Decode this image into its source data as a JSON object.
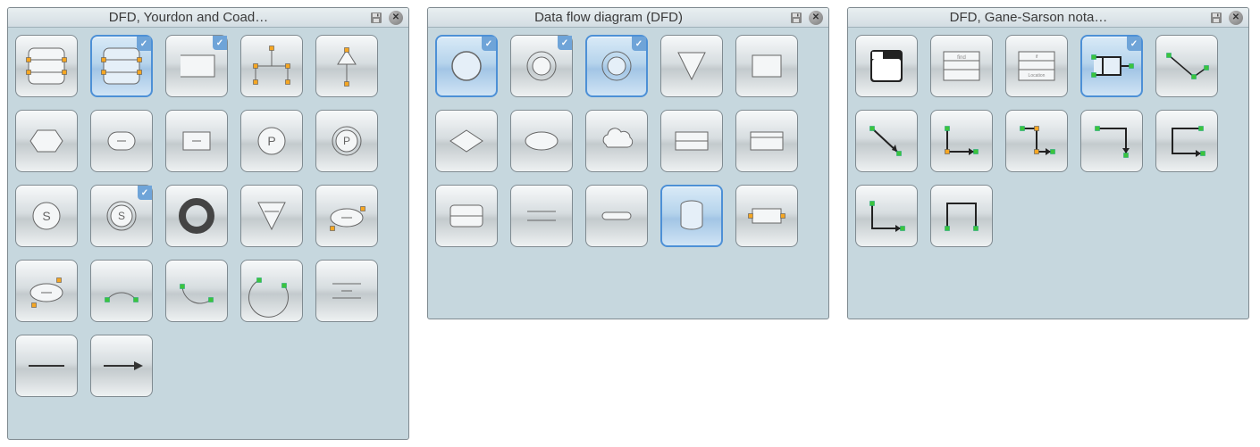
{
  "panels": [
    {
      "id": "yourdon",
      "title": "DFD, Yourdon and Coad…",
      "className": "panel-a",
      "shapes": [
        {
          "name": "data-store-1",
          "icon": "rows3",
          "handles": "o",
          "selected": false,
          "tick": false
        },
        {
          "name": "data-store-2",
          "icon": "rows3",
          "handles": "o",
          "selected": true,
          "tick": true
        },
        {
          "name": "data-store-open",
          "icon": "openrect",
          "selected": false,
          "tick": true
        },
        {
          "name": "tree-shape",
          "icon": "tree",
          "handles": "o",
          "selected": false,
          "tick": false
        },
        {
          "name": "triangle-up-branch",
          "icon": "triupline",
          "handles": "o",
          "selected": false,
          "tick": false
        },
        {
          "name": "hex-process",
          "icon": "hex",
          "selected": false,
          "tick": false
        },
        {
          "name": "rounded-minus",
          "icon": "roundminus",
          "selected": false,
          "tick": false
        },
        {
          "name": "rect-minus",
          "icon": "rectminus",
          "selected": false,
          "tick": false
        },
        {
          "name": "process-p",
          "icon": "circleP",
          "selected": false,
          "tick": false
        },
        {
          "name": "process-p-ring",
          "icon": "circlePring",
          "selected": false,
          "tick": false
        },
        {
          "name": "state-s",
          "icon": "circleS",
          "selected": false,
          "tick": false
        },
        {
          "name": "state-s-ring",
          "icon": "circleSring",
          "selected": false,
          "tick": true
        },
        {
          "name": "ring-bold",
          "icon": "boldring",
          "selected": false,
          "tick": false
        },
        {
          "name": "triangle-down",
          "icon": "tridown",
          "selected": false,
          "tick": false
        },
        {
          "name": "ellipse-minus-handles",
          "icon": "ellminus",
          "handles": "o",
          "selected": false,
          "tick": false
        },
        {
          "name": "ellipse-minus",
          "icon": "ellminus2",
          "handles": "o",
          "selected": false,
          "tick": false
        },
        {
          "name": "arc-handles-1",
          "icon": "arc",
          "handles": "g",
          "selected": false,
          "tick": false
        },
        {
          "name": "arc-handles-2",
          "icon": "arc2",
          "handles": "g",
          "selected": false,
          "tick": false
        },
        {
          "name": "arc-handles-3",
          "icon": "arc3",
          "handles": "g",
          "selected": false,
          "tick": false
        },
        {
          "name": "parallel-minus",
          "icon": "parminus",
          "selected": false,
          "tick": false
        },
        {
          "name": "line-plain",
          "icon": "line",
          "selected": false,
          "tick": false
        },
        {
          "name": "arrow-right",
          "icon": "arrow",
          "selected": false,
          "tick": false
        }
      ]
    },
    {
      "id": "dfd",
      "title": "Data flow diagram (DFD)",
      "className": "panel-b",
      "shapes": [
        {
          "name": "circle-big",
          "icon": "circle",
          "selected": true,
          "tick": true
        },
        {
          "name": "circle-ring",
          "icon": "ring",
          "selected": false,
          "tick": true
        },
        {
          "name": "circle-ring-sel",
          "icon": "ring",
          "selected": true,
          "tick": true
        },
        {
          "name": "triangle-down-outline",
          "icon": "tridownout",
          "selected": false,
          "tick": false
        },
        {
          "name": "rect-outline",
          "icon": "rect",
          "selected": false,
          "tick": false
        },
        {
          "name": "diamond",
          "icon": "diamond",
          "selected": false,
          "tick": false
        },
        {
          "name": "ellipse-outline",
          "icon": "ellipse",
          "selected": false,
          "tick": false
        },
        {
          "name": "cloud",
          "icon": "cloud",
          "selected": false,
          "tick": false
        },
        {
          "name": "rect-2split",
          "icon": "rect2",
          "selected": false,
          "tick": false
        },
        {
          "name": "rect-top-band",
          "icon": "recttop",
          "selected": false,
          "tick": false
        },
        {
          "name": "rows-2",
          "icon": "rows2",
          "selected": false,
          "tick": false
        },
        {
          "name": "two-lines",
          "icon": "twolines",
          "selected": false,
          "tick": false
        },
        {
          "name": "pill-line",
          "icon": "pillline",
          "selected": false,
          "tick": false
        },
        {
          "name": "cylinder",
          "icon": "cyl",
          "selected": true,
          "tick": false
        },
        {
          "name": "rect-mid-handles",
          "icon": "rectmid",
          "handles": "o",
          "selected": false,
          "tick": false
        }
      ]
    },
    {
      "id": "gane",
      "title": "DFD, Gane-Sarson nota…",
      "className": "panel-c",
      "shapes": [
        {
          "name": "process-box",
          "icon": "procbox",
          "selected": false,
          "tick": false
        },
        {
          "name": "table-3col",
          "icon": "tbl3",
          "selected": false,
          "tick": false
        },
        {
          "name": "table-labels",
          "icon": "tbllbl",
          "selected": false,
          "tick": false
        },
        {
          "name": "open-store",
          "icon": "openstore",
          "handles": "g",
          "selected": true,
          "tick": true
        },
        {
          "name": "angled-connector",
          "icon": "angled",
          "handles": "g",
          "selected": false,
          "tick": false
        },
        {
          "name": "diag-arrow",
          "icon": "diagarrow",
          "handles": "g",
          "selected": false,
          "tick": false
        },
        {
          "name": "elbow-1",
          "icon": "elbow1",
          "handles": "go",
          "selected": false,
          "tick": false
        },
        {
          "name": "elbow-2",
          "icon": "elbow2",
          "handles": "go",
          "selected": false,
          "tick": false
        },
        {
          "name": "elbow-3",
          "icon": "elbow3",
          "handles": "g",
          "selected": false,
          "tick": false
        },
        {
          "name": "elbow-4",
          "icon": "elbow4",
          "handles": "g",
          "selected": false,
          "tick": false
        },
        {
          "name": "u-connector-1",
          "icon": "uconn1",
          "handles": "g",
          "selected": false,
          "tick": false
        },
        {
          "name": "u-connector-2",
          "icon": "uconn2",
          "handles": "g",
          "selected": false,
          "tick": false
        }
      ]
    }
  ]
}
